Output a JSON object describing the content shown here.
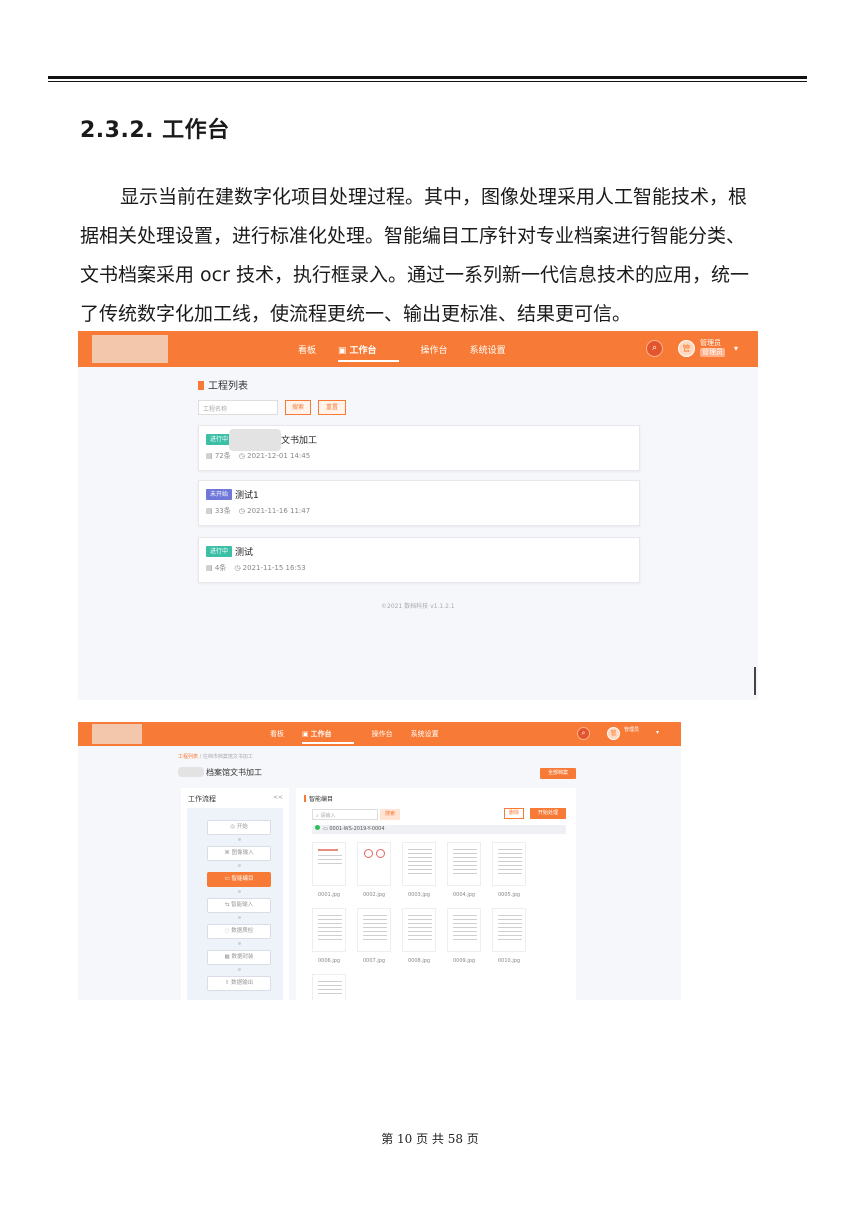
{
  "heading": "2.3.2. 工作台",
  "paragraph_lines": [
    "显示当前在建数字化项目处理过程。其中，图像处理采用人工智能技术，根",
    "据相关处理设置，进行标准化处理。智能编目工序针对专业档案进行智能分类、",
    "文书档案采用 ocr 技术，执行框录入。通过一系列新一代信息技术的应用，统一",
    "了传统数字化加工线，使流程更统一、输出更标准、结果更可信。"
  ],
  "accent_color": "#f77b36",
  "shot1": {
    "nav": [
      "看板",
      "工作台",
      "操作台",
      "系统设置"
    ],
    "active_nav_index": 1,
    "search_glyph": "⌕",
    "avatar_text": "管",
    "user_name": "管理员",
    "user_role": "管理员",
    "dropdown_glyph": "▾",
    "list_title": "工程列表",
    "search_placeholder": "工程名称",
    "search_button": "搜索",
    "reset_button": "重置",
    "projects": [
      {
        "tag": "进行中",
        "tag_color": "#3bbfa6",
        "name": "文书加工",
        "count": "72条",
        "time": "2021-12-01 14:45"
      },
      {
        "tag": "未开始",
        "tag_color": "#6f77d8",
        "name": "测试1",
        "count": "33条",
        "time": "2021-11-16 11:47"
      },
      {
        "tag": "进行中",
        "tag_color": "#3bbfa6",
        "name": "测试",
        "count": "4条",
        "time": "2021-11-15 16:53"
      }
    ],
    "footer": "©2021 数档科技 v1.1.2.1"
  },
  "shot2": {
    "nav": [
      "看板",
      "工作台",
      "操作台",
      "系统设置"
    ],
    "active_nav_index": 1,
    "search_glyph": "⌕",
    "avatar_text": "管",
    "user_name": "管理员",
    "dropdown_glyph": "▾",
    "breadcrumb_link": "工程列表",
    "breadcrumb_sep": " / ",
    "breadcrumb_current": "在档市档案馆文书加工",
    "project_title": "档案馆文书加工",
    "all_button": "全部档案",
    "workflow_title": "工作流程",
    "workflow_collapse": "<<",
    "steps": [
      "开始",
      "图像输入",
      "智能编目",
      "智能输入",
      "数据质检",
      "数据封装",
      "数据输出"
    ],
    "active_step_index": 2,
    "catalog_title": "智能编目",
    "catalog_search_placeholder": "请输入",
    "catalog_search_button": "搜索",
    "delete_button": "删除",
    "start_button": "开始处理",
    "folder_name": "0001-WS-2019-Y-0004",
    "thumbnails": [
      "0001.jpg",
      "0002.jpg",
      "0003.jpg",
      "0004.jpg",
      "0005.jpg",
      "0006.jpg",
      "0007.jpg",
      "0008.jpg",
      "0009.jpg",
      "0010.jpg",
      ""
    ]
  },
  "page_number": "第 10 页 共 58 页"
}
